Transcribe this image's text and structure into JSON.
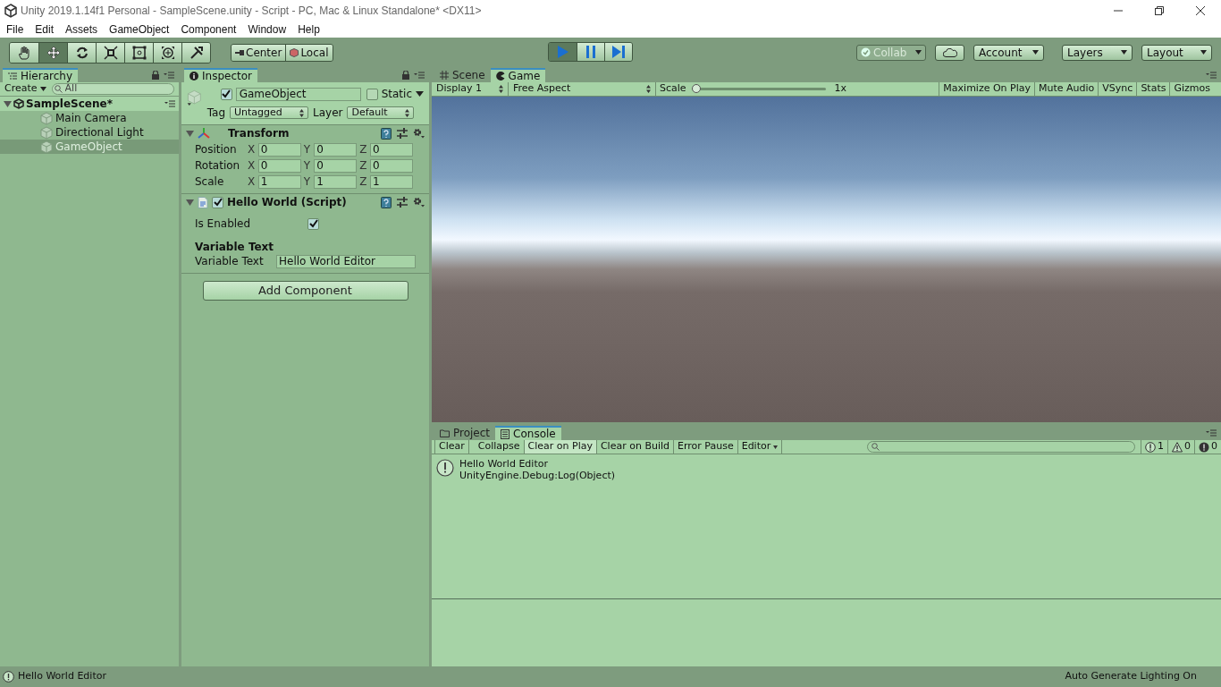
{
  "window": {
    "title": "Unity 2019.1.14f1 Personal - SampleScene.unity - Script - PC, Mac & Linux Standalone* <DX11>"
  },
  "menu": [
    "File",
    "Edit",
    "Assets",
    "GameObject",
    "Component",
    "Window",
    "Help"
  ],
  "toolbar": {
    "tools": [
      {
        "kind": "hand",
        "selected": false
      },
      {
        "kind": "move",
        "selected": true
      },
      {
        "kind": "rotate",
        "selected": false
      },
      {
        "kind": "scale",
        "selected": false
      },
      {
        "kind": "rect",
        "selected": false
      },
      {
        "kind": "transform",
        "selected": false
      },
      {
        "kind": "custom",
        "selected": false
      }
    ],
    "pivot": [
      "Center",
      "Local"
    ],
    "play": [
      {
        "kind": "play",
        "selected": true
      },
      {
        "kind": "pause",
        "selected": false
      },
      {
        "kind": "step",
        "selected": false
      }
    ],
    "collab": "Collab",
    "account": "Account",
    "layers": "Layers",
    "layout": "Layout"
  },
  "hierarchy": {
    "tab": "Hierarchy",
    "create": "Create",
    "search_placeholder": "All",
    "scene": {
      "name": "SampleScene*",
      "expanded": true,
      "children": [
        {
          "label": "Main Camera",
          "selected": false
        },
        {
          "label": "Directional Light",
          "selected": false
        },
        {
          "label": "GameObject",
          "selected": true
        }
      ]
    }
  },
  "inspector": {
    "tab": "Inspector",
    "object": {
      "active": true,
      "name": "GameObject",
      "static_label": "Static",
      "static": false,
      "tag_label": "Tag",
      "tag": "Untagged",
      "layer_label": "Layer",
      "layer": "Default"
    },
    "components": [
      {
        "kind": "transform",
        "title": "Transform",
        "expanded": true,
        "rows": [
          {
            "label": "Position",
            "values": [
              {
                "axis": "X",
                "value": "0"
              },
              {
                "axis": "Y",
                "value": "0"
              },
              {
                "axis": "Z",
                "value": "0"
              }
            ]
          },
          {
            "label": "Rotation",
            "values": [
              {
                "axis": "X",
                "value": "0"
              },
              {
                "axis": "Y",
                "value": "0"
              },
              {
                "axis": "Z",
                "value": "0"
              }
            ]
          },
          {
            "label": "Scale",
            "values": [
              {
                "axis": "X",
                "value": "1"
              },
              {
                "axis": "Y",
                "value": "1"
              },
              {
                "axis": "Z",
                "value": "1"
              }
            ]
          }
        ]
      },
      {
        "kind": "script",
        "title": "Hello World (Script)",
        "expanded": true,
        "enabled": true,
        "fields": [
          {
            "kind": "toggle",
            "label": "Is Enabled",
            "checked": true
          },
          {
            "kind": "header",
            "label": "Variable Text"
          },
          {
            "kind": "text",
            "label": "Variable Text",
            "value": "Hello World Editor"
          }
        ]
      }
    ],
    "add_component": "Add Component"
  },
  "game": {
    "tabs": [
      {
        "label": "Scene",
        "selected": false
      },
      {
        "label": "Game",
        "selected": true
      }
    ],
    "display": "Display 1",
    "aspect": "Free Aspect",
    "scale_label": "Scale",
    "scale": {
      "level": 0
    },
    "scale_value": "1x",
    "buttons": [
      "Maximize On Play",
      "Mute Audio",
      "VSync",
      "Stats",
      "Gizmos"
    ]
  },
  "console": {
    "tabs": [
      {
        "label": "Project",
        "selected": false
      },
      {
        "label": "Console",
        "selected": true
      }
    ],
    "buttons": [
      {
        "label": "Clear",
        "on": false
      },
      {
        "label": "Collapse",
        "on": false
      },
      {
        "label": "Clear on Play",
        "on": true
      },
      {
        "label": "Clear on Build",
        "on": false
      },
      {
        "label": "Error Pause",
        "on": false
      },
      {
        "label": "Editor",
        "on": false
      }
    ],
    "counts": [
      {
        "kind": "info",
        "count": "1"
      },
      {
        "kind": "warning",
        "count": "0"
      },
      {
        "kind": "error",
        "count": "0"
      }
    ],
    "entries": [
      {
        "kind": "info",
        "lines": [
          "Hello World Editor",
          "UnityEngine.Debug:Log(Object)"
        ]
      }
    ]
  },
  "status_bar": {
    "message": "Hello World Editor",
    "right": "Auto Generate Lighting On"
  }
}
